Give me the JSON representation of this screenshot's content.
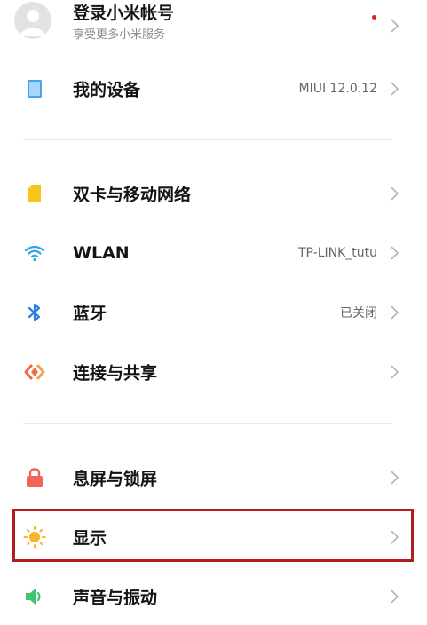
{
  "account": {
    "title": "登录小米帐号",
    "subtitle": "享受更多小米服务",
    "notification_dot_color": "#e02424"
  },
  "items": [
    {
      "label": "我的设备",
      "value": "MIUI 12.0.12",
      "icon": "phone-icon",
      "icon_color": "#4ba3e8"
    },
    {
      "label": "双卡与移动网络",
      "value": "",
      "icon": "sim-card-icon",
      "icon_color": "#f5c518"
    },
    {
      "label": "WLAN",
      "value": "TP-LINK_tutu",
      "icon": "wifi-icon",
      "icon_color": "#2ea3e8"
    },
    {
      "label": "蓝牙",
      "value": "已关闭",
      "icon": "bluetooth-icon",
      "icon_color": "#2b7de0"
    },
    {
      "label": "连接与共享",
      "value": "",
      "icon": "share-icon",
      "icon_color": "#f06a4a"
    },
    {
      "label": "息屏与锁屏",
      "value": "",
      "icon": "lock-icon",
      "icon_color": "#f0645a"
    },
    {
      "label": "显示",
      "value": "",
      "icon": "sun-icon",
      "icon_color": "#f7b52a",
      "highlighted": true
    },
    {
      "label": "声音与振动",
      "value": "",
      "icon": "speaker-icon",
      "icon_color": "#3fc46a"
    }
  ],
  "highlight_color": "#b01e1e"
}
